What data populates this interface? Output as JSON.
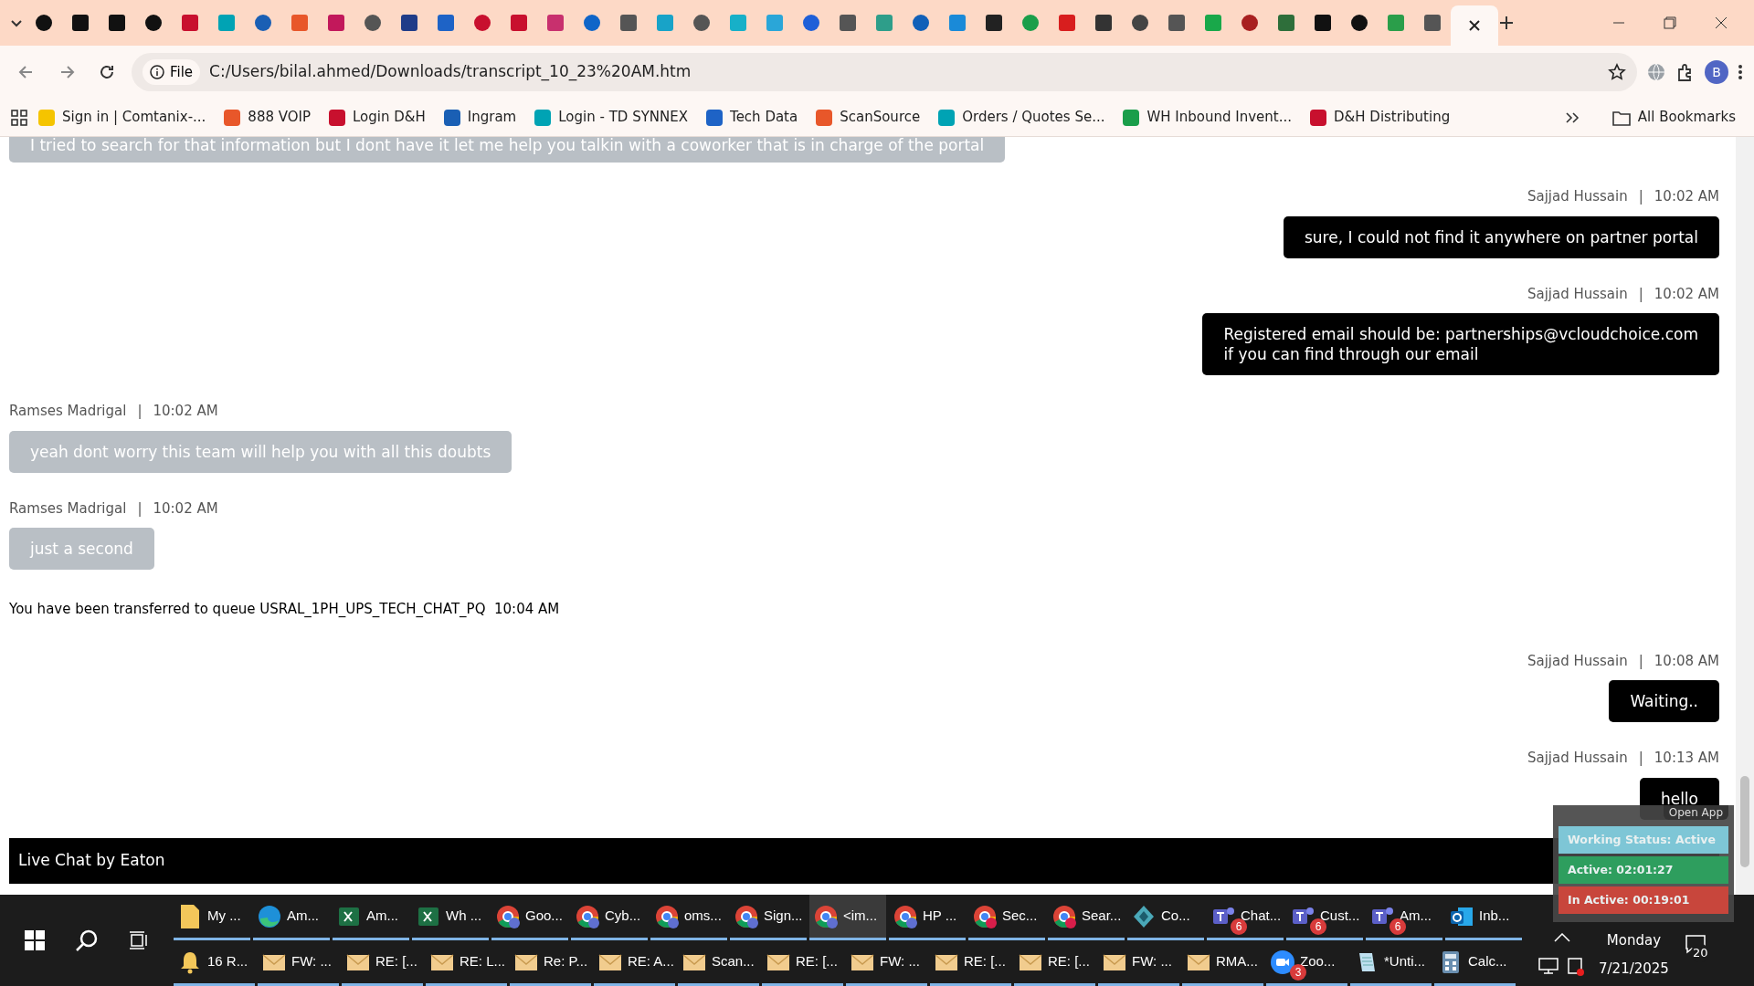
{
  "browser": {
    "tabs": [
      {
        "color": "#111111",
        "selected": false
      },
      {
        "color": "#111111",
        "selected": false
      },
      {
        "color": "#111111",
        "selected": false
      },
      {
        "color": "#111111",
        "selected": false
      },
      {
        "color": "#c8102e",
        "selected": false
      },
      {
        "color": "#00a3b4",
        "selected": false
      },
      {
        "color": "#1a5fb4",
        "selected": false
      },
      {
        "color": "#e8572a",
        "selected": false
      },
      {
        "color": "#c2185b",
        "selected": false
      },
      {
        "color": "#555555",
        "selected": false
      },
      {
        "color": "#1f3c88",
        "selected": false
      },
      {
        "color": "#1e63c6",
        "selected": false
      },
      {
        "color": "#c8102e",
        "selected": false
      },
      {
        "color": "#c8102e",
        "selected": false
      },
      {
        "color": "#c8306e",
        "selected": false
      },
      {
        "color": "#0f65c8",
        "selected": false
      },
      {
        "color": "#555555",
        "selected": false
      },
      {
        "color": "#18a3c8",
        "selected": false
      },
      {
        "color": "#555555",
        "selected": false
      },
      {
        "color": "#17b0c8",
        "selected": false
      },
      {
        "color": "#2aa6d8",
        "selected": false
      },
      {
        "color": "#1e5fd8",
        "selected": false
      },
      {
        "color": "#555555",
        "selected": false
      },
      {
        "color": "#2e9e8a",
        "selected": false
      },
      {
        "color": "#1160b8",
        "selected": false
      },
      {
        "color": "#1a8ad8",
        "selected": false
      },
      {
        "color": "#222222",
        "selected": false
      },
      {
        "color": "#1a9e4a",
        "selected": false
      },
      {
        "color": "#d81e1e",
        "selected": false
      },
      {
        "color": "#333333",
        "selected": false
      },
      {
        "color": "#444444",
        "selected": false
      },
      {
        "color": "#555555",
        "selected": false
      },
      {
        "color": "#19a84a",
        "selected": false
      },
      {
        "color": "#a82020",
        "selected": false
      },
      {
        "color": "#2e6e3a",
        "selected": false
      },
      {
        "color": "#111111",
        "selected": false
      },
      {
        "color": "#111111",
        "selected": false
      },
      {
        "color": "#2a9e4a",
        "selected": false
      },
      {
        "color": "#555555",
        "selected": false
      },
      {
        "selected": true
      }
    ],
    "file_chip": "File",
    "url": "C:/Users/bilal.ahmed/Downloads/transcript_10_23%20AM.htm",
    "profile": "B",
    "bookmarks": [
      {
        "label": "Sign in | Comtanix-...",
        "color": "#f5c400"
      },
      {
        "label": "888 VOIP",
        "color": "#e8572a"
      },
      {
        "label": "Login D&H",
        "color": "#c8102e"
      },
      {
        "label": "Ingram",
        "color": "#1a5fb4"
      },
      {
        "label": "Login - TD SYNNEX",
        "color": "#00a3b4"
      },
      {
        "label": "Tech Data",
        "color": "#1e63c6"
      },
      {
        "label": "ScanSource",
        "color": "#e8572a"
      },
      {
        "label": "Orders / Quotes Se...",
        "color": "#00a3b4"
      },
      {
        "label": "WH Inbound Invent...",
        "color": "#1a9e4a"
      },
      {
        "label": "D&H Distributing",
        "color": "#c8102e"
      }
    ],
    "all_bookmarks": "All Bookmarks"
  },
  "chat": {
    "messages": [
      {
        "kind": "agent",
        "lines": [
          "I tried to search for that information but I dont have it let me help you talkin with a coworker that is in charge of the portal"
        ]
      },
      {
        "kind": "customer",
        "sender": "Sajjad Hussain",
        "separator": "|",
        "time": "10:02 AM",
        "lines": [
          "sure, I could not find it anywhere on partner portal"
        ]
      },
      {
        "kind": "customer",
        "sender": "Sajjad Hussain",
        "separator": "|",
        "time": "10:02 AM",
        "lines": [
          "Registered email should be: partnerships@vcloudchoice.com",
          "if you can find through our email"
        ]
      },
      {
        "kind": "agent",
        "sender": "Ramses Madrigal",
        "separator": "|",
        "time": "10:02 AM",
        "lines": [
          "yeah dont worry this team will help you with all this doubts"
        ]
      },
      {
        "kind": "agent",
        "sender": "Ramses Madrigal",
        "separator": "|",
        "time": "10:02 AM",
        "lines": [
          "just a second"
        ]
      },
      {
        "kind": "system",
        "lines": [
          "You have been transferred to queue USRAL_1PH_UPS_TECH_CHAT_PQ  10:04 AM"
        ]
      },
      {
        "kind": "customer",
        "sender": "Sajjad Hussain",
        "separator": "|",
        "time": "10:08 AM",
        "lines": [
          "Waiting.."
        ]
      },
      {
        "kind": "customer",
        "sender": "Sajjad Hussain",
        "separator": "|",
        "time": "10:13 AM",
        "lines": [
          "hello"
        ]
      }
    ],
    "footer": "Live Chat by Eaton"
  },
  "status_widget": {
    "open_app": "Open App",
    "rows": [
      {
        "label": "Working Status: Active",
        "color": "#7ec6d6"
      },
      {
        "label": "Active: 02:01:27",
        "color": "#2e9e5e"
      },
      {
        "label": "In Active: 00:19:01",
        "color": "#c8463c"
      }
    ]
  },
  "taskbar": {
    "row_1": [
      {
        "label": "My ...",
        "kind": "folder",
        "selected": false
      },
      {
        "label": "Am...",
        "kind": "edge",
        "selected": false
      },
      {
        "label": "Am...",
        "kind": "excel",
        "selected": false
      },
      {
        "label": "Wh ...",
        "kind": "excel",
        "selected": false
      },
      {
        "label": "Goo...",
        "kind": "chrome",
        "selected": false
      },
      {
        "label": "Cyb...",
        "kind": "chrome",
        "selected": false
      },
      {
        "label": "oms...",
        "kind": "chrome",
        "selected": false
      },
      {
        "label": "Sign...",
        "kind": "chrome",
        "selected": false
      },
      {
        "label": "<im...",
        "kind": "chrome",
        "selected": true
      },
      {
        "label": "HP ...",
        "kind": "chrome",
        "selected": false
      },
      {
        "label": "Sec...",
        "kind": "chromered",
        "selected": false
      },
      {
        "label": "Sear...",
        "kind": "chromered",
        "selected": false
      },
      {
        "label": "Co...",
        "kind": "cube",
        "selected": false
      },
      {
        "label": "Chat...",
        "kind": "teams",
        "badge": "6",
        "selected": false
      },
      {
        "label": "Cust...",
        "kind": "teams",
        "badge": "6",
        "selected": false
      },
      {
        "label": "Am...",
        "kind": "teams",
        "badge": "6",
        "selected": false
      },
      {
        "label": "Inb...",
        "kind": "outlook",
        "selected": false
      }
    ],
    "row_2": [
      {
        "label": "16 R...",
        "kind": "bell",
        "selected": false
      },
      {
        "label": "FW: ...",
        "kind": "mail",
        "selected": false
      },
      {
        "label": "RE: [...",
        "kind": "mail",
        "selected": false
      },
      {
        "label": "RE: L...",
        "kind": "mail",
        "selected": false
      },
      {
        "label": "Re: P...",
        "kind": "mail",
        "selected": false
      },
      {
        "label": "RE: A...",
        "kind": "mail",
        "selected": false
      },
      {
        "label": "Scan...",
        "kind": "mail",
        "selected": false
      },
      {
        "label": "RE: [...",
        "kind": "mail",
        "selected": false
      },
      {
        "label": "FW: ...",
        "kind": "mail",
        "selected": false
      },
      {
        "label": "RE: [...",
        "kind": "mail",
        "selected": false
      },
      {
        "label": "RE: [...",
        "kind": "mail",
        "selected": false
      },
      {
        "label": "FW: ...",
        "kind": "mail",
        "selected": false
      },
      {
        "label": "RMA...",
        "kind": "mail",
        "selected": false
      },
      {
        "label": "Zoo...",
        "kind": "zoom",
        "badge": "3",
        "selected": false
      },
      {
        "label": "*Unti...",
        "kind": "notepad",
        "selected": false
      },
      {
        "label": "Calc...",
        "kind": "calc",
        "selected": false
      }
    ],
    "day": "Monday",
    "date": "7/21/2025",
    "notifications": "20"
  }
}
